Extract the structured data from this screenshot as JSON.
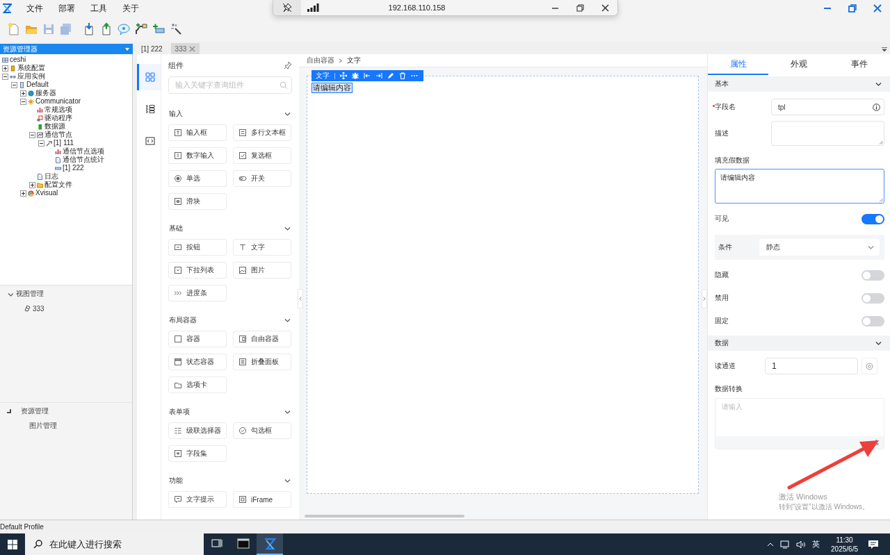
{
  "menu": [
    "文件",
    "部署",
    "工具",
    "关于"
  ],
  "toolbar": [
    {
      "kind": "new",
      "disabled": false
    },
    {
      "kind": "open",
      "disabled": false
    },
    {
      "kind": "save",
      "disabled": true
    },
    {
      "kind": "save-all",
      "disabled": true
    },
    {
      "kind": "import",
      "disabled": false
    },
    {
      "kind": "export",
      "disabled": false
    },
    {
      "kind": "help",
      "disabled": false
    },
    {
      "kind": "plug",
      "disabled": false
    },
    {
      "kind": "add",
      "disabled": false
    },
    {
      "kind": "wand",
      "disabled": false
    }
  ],
  "remote_bar": {
    "address": "192.168.110.158"
  },
  "tabs": [
    {
      "label": "[1] 222",
      "selected": false,
      "closable": false
    },
    {
      "label": "333",
      "selected": true,
      "closable": true
    }
  ],
  "explorer": {
    "title": "资源管理器",
    "tree": [
      {
        "label": "ceshi",
        "kind": "project",
        "children": [
          {
            "label": "系统配置",
            "kind": "config",
            "expanded": false
          },
          {
            "label": "应用实例",
            "kind": "app",
            "expanded": true,
            "children": [
              {
                "label": "Default",
                "kind": "device",
                "expanded": true,
                "children": [
                  {
                    "label": "服务器",
                    "kind": "globe",
                    "expanded": false
                  },
                  {
                    "label": "Communicator",
                    "kind": "gear",
                    "expanded": true,
                    "children": [
                      {
                        "label": "常规选项",
                        "kind": "options"
                      },
                      {
                        "label": "驱动程序",
                        "kind": "driver"
                      },
                      {
                        "label": "数据源",
                        "kind": "data"
                      },
                      {
                        "label": "通信节点",
                        "kind": "nodes",
                        "expanded": true,
                        "children": [
                          {
                            "label": "[1] 111",
                            "kind": "node",
                            "expanded": true,
                            "children": [
                              {
                                "label": "通信节点选项",
                                "kind": "options"
                              },
                              {
                                "label": "通信节点统计",
                                "kind": "doc"
                              },
                              {
                                "label": "[1] 222",
                                "kind": "link"
                              }
                            ]
                          }
                        ]
                      },
                      {
                        "label": "日志",
                        "kind": "doc"
                      },
                      {
                        "label": "配置文件",
                        "kind": "folder",
                        "expanded": false
                      }
                    ]
                  },
                  {
                    "label": "Xvisual",
                    "kind": "browser",
                    "expanded": false
                  }
                ]
              }
            ]
          }
        ]
      }
    ]
  },
  "view_manager": {
    "title": "视图管理",
    "expanded": true,
    "items": [
      "333"
    ]
  },
  "resource_manager": {
    "title": "资源管理",
    "items": [
      "图片管理"
    ]
  },
  "rail": [
    {
      "kind": "grid",
      "selected": true
    },
    {
      "kind": "tree",
      "selected": false
    },
    {
      "kind": "code",
      "selected": false
    }
  ],
  "components": {
    "title": "组件",
    "search_placeholder": "输入关键字查询组件",
    "groups": [
      {
        "title": "输入",
        "expanded": true,
        "items": [
          {
            "label": "输入框",
            "kind": "input"
          },
          {
            "label": "多行文本框",
            "kind": "textarea"
          },
          {
            "label": "数字输入",
            "kind": "number"
          },
          {
            "label": "复选框",
            "kind": "checkbox"
          },
          {
            "label": "单选",
            "kind": "radio"
          },
          {
            "label": "开关",
            "kind": "switch"
          },
          {
            "label": "滑块",
            "kind": "slider"
          }
        ]
      },
      {
        "title": "基础",
        "expanded": true,
        "items": [
          {
            "label": "按钮",
            "kind": "button"
          },
          {
            "label": "文字",
            "kind": "text"
          },
          {
            "label": "下拉列表",
            "kind": "select"
          },
          {
            "label": "图片",
            "kind": "image"
          },
          {
            "label": "进度条",
            "kind": "progress"
          }
        ]
      },
      {
        "title": "布局容器",
        "expanded": true,
        "items": [
          {
            "label": "容器",
            "kind": "container"
          },
          {
            "label": "自由容器",
            "kind": "free"
          },
          {
            "label": "状态容器",
            "kind": "state"
          },
          {
            "label": "折叠面板",
            "kind": "collapse"
          },
          {
            "label": "选项卡",
            "kind": "tabs"
          }
        ]
      },
      {
        "title": "表单项",
        "expanded": true,
        "items": [
          {
            "label": "级联选择器",
            "kind": "cascader"
          },
          {
            "label": "勾选框",
            "kind": "check"
          },
          {
            "label": "字段集",
            "kind": "fieldset"
          }
        ]
      },
      {
        "title": "功能",
        "expanded": true,
        "items": [
          {
            "label": "文字提示",
            "kind": "tooltip"
          },
          {
            "label": "iFrame",
            "kind": "iframe"
          }
        ]
      }
    ]
  },
  "canvas": {
    "breadcrumb": [
      "自由容器",
      "文字"
    ],
    "selection_label": "文字",
    "text": "请编辑内容"
  },
  "properties": {
    "tabs": [
      {
        "label": "属性",
        "selected": true
      },
      {
        "label": "外观",
        "selected": false
      },
      {
        "label": "事件",
        "selected": false
      }
    ],
    "sections": [
      {
        "title": "基本",
        "expanded": true,
        "rows": [
          {
            "kind": "input",
            "label": "字段名",
            "required": true,
            "value": "tpl"
          },
          {
            "kind": "textarea",
            "label": "描述"
          },
          {
            "kind": "area",
            "label": "填充假数据",
            "value": "请编辑内容",
            "focused": true
          },
          {
            "kind": "toggle",
            "label": "可见",
            "on": true
          },
          {
            "kind": "select",
            "label": "条件",
            "value": "静态"
          },
          {
            "kind": "toggle",
            "label": "隐藏",
            "on": false
          },
          {
            "kind": "toggle",
            "label": "禁用",
            "on": false
          },
          {
            "kind": "toggle",
            "label": "固定",
            "on": false
          }
        ]
      },
      {
        "title": "数据",
        "expanded": true,
        "rows": [
          {
            "kind": "picker",
            "label": "读通道",
            "value": "1"
          },
          {
            "kind": "code",
            "label": "数据转换",
            "placeholder": "请输入"
          }
        ]
      }
    ]
  },
  "watermark": {
    "title": "激活 Windows",
    "hint": "转到“设置”以激活 Windows。"
  },
  "status_bar": "Default Profile",
  "taskbar": {
    "search_placeholder": "在此键入进行搜索",
    "apps": [
      {
        "kind": "task-view",
        "active": false
      },
      {
        "kind": "terminal",
        "active": false
      },
      {
        "kind": "designer",
        "active": true
      }
    ],
    "ime": "英",
    "time": "11:30",
    "date": "2025/6/5"
  }
}
